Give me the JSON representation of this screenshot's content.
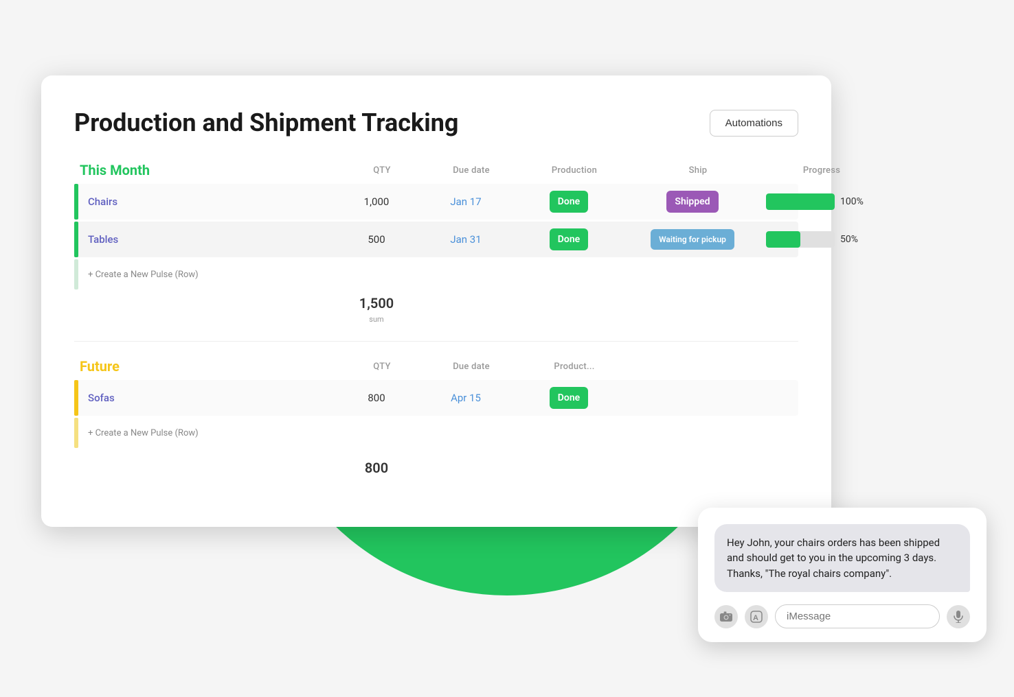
{
  "page": {
    "title": "Production and Shipment Tracking",
    "automations_button": "Automations"
  },
  "this_month": {
    "label": "This Month",
    "columns": {
      "qty": "QTY",
      "due_date": "Due date",
      "production": "Production",
      "ship": "Ship",
      "progress": "Progress"
    },
    "rows": [
      {
        "name": "Chairs",
        "qty": "1,000",
        "due_date": "Jan 17",
        "production": "Done",
        "ship": "Shipped",
        "progress_pct": 100,
        "progress_label": "100%"
      },
      {
        "name": "Tables",
        "qty": "500",
        "due_date": "Jan 31",
        "production": "Done",
        "ship": "Waiting for pickup",
        "progress_pct": 50,
        "progress_label": "50%"
      }
    ],
    "create_row_label": "+ Create a New Pulse (Row)",
    "sum_value": "1,500",
    "sum_label": "sum"
  },
  "future": {
    "label": "Future",
    "columns": {
      "qty": "QTY",
      "due_date": "Due date",
      "production": "Product..."
    },
    "rows": [
      {
        "name": "Sofas",
        "qty": "800",
        "due_date": "Apr 15",
        "production": "Done"
      }
    ],
    "create_row_label": "+ Create a New Pulse (Row)",
    "sum_value": "800"
  },
  "imessage": {
    "bubble_text": "Hey John, your chairs orders has been shipped and should get to you in the upcoming 3 days. Thanks, \"The royal chairs company\".",
    "input_placeholder": "iMessage",
    "icons": {
      "camera": "📷",
      "appstore": "🅐",
      "mic": "🎤"
    }
  }
}
